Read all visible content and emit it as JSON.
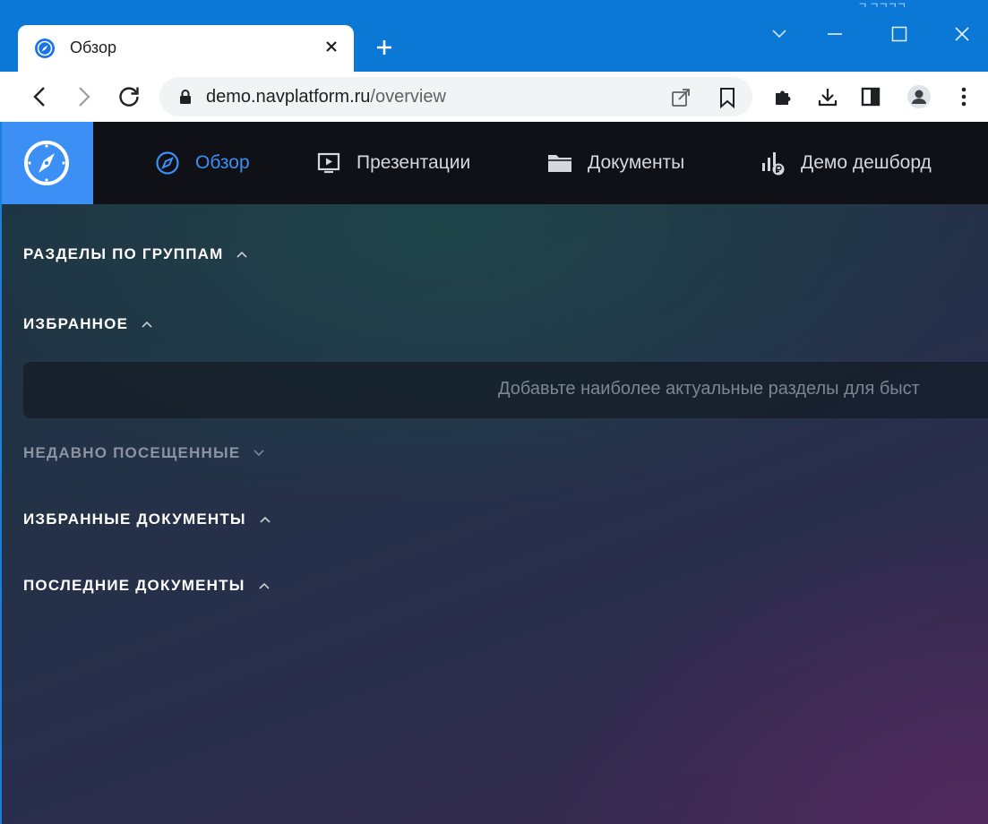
{
  "browser": {
    "tab_title": "Обзор",
    "url_host": "demo.navplatform.ru",
    "url_path": "/overview",
    "topright_text": "ᄀ ᄀᄀᄀᄀ",
    "accent": "#0a78d4"
  },
  "app": {
    "brand_color": "#3b8ff5",
    "nav": [
      {
        "label": "Обзор",
        "icon": "compass-icon",
        "active": true
      },
      {
        "label": "Презентации",
        "icon": "presentation-icon"
      },
      {
        "label": "Документы",
        "icon": "folder-icon"
      },
      {
        "label": "Демо дешборд",
        "icon": "dashboard-chart-icon"
      }
    ],
    "sections": {
      "groups": "РАЗДЕЛЫ ПО ГРУППАМ",
      "favorites": "ИЗБРАННОЕ",
      "favorites_hint": "Добавьте наиболее актуальные разделы для быст",
      "recent": "НЕДАВНО ПОСЕЩЕННЫЕ",
      "fav_docs": "ИЗБРАННЫЕ ДОКУМЕНТЫ",
      "last_docs": "ПОСЛЕДНИЕ ДОКУМЕНТЫ"
    }
  }
}
